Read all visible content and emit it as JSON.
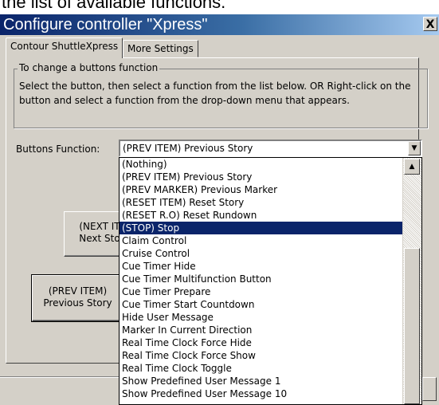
{
  "caption": "the list of available functions.",
  "window": {
    "title": "Configure controller \"Xpress\"",
    "close_glyph": "X"
  },
  "tabs": [
    {
      "label": "Contour ShuttleXpress",
      "active": true
    },
    {
      "label": "More Settings",
      "active": false
    }
  ],
  "groupbox": {
    "legend": "To change a buttons function",
    "text": "Select the button, then select a function from the list below. OR Right-click on the button and select a function from the drop-down menu that appears."
  },
  "buttons_function": {
    "label": "Buttons Function:",
    "selected_value": "(PREV ITEM) Previous Story"
  },
  "controller_buttons": {
    "next_line1": "(NEXT IT",
    "next_line2": "Next Sto",
    "prev_line1": "(PREV ITEM)",
    "prev_line2": "Previous Story"
  },
  "dropdown": {
    "selected_index": 5,
    "options": [
      "(Nothing)",
      "(PREV ITEM) Previous Story",
      "(PREV MARKER) Previous Marker",
      "(RESET ITEM) Reset Story",
      "(RESET R.O) Reset Rundown",
      "(STOP) Stop",
      "Claim Control",
      "Cruise Control",
      "Cue Timer Hide",
      "Cue Timer Multifunction Button",
      "Cue Timer Prepare",
      "Cue Timer Start Countdown",
      "Hide User Message",
      "Marker In Current Direction",
      "Real Time Clock Force Hide",
      "Real Time Clock Force Show",
      "Real Time Clock Toggle",
      "Show Predefined User Message 1",
      "Show Predefined User Message 10"
    ]
  },
  "icons": {
    "combo_arrow": "down-arrow-icon",
    "scroll_up": "up-arrow-icon",
    "close": "close-icon"
  },
  "colors": {
    "title_start": "#0a246a",
    "selection": "#0a246a",
    "face": "#d4d0c8"
  }
}
